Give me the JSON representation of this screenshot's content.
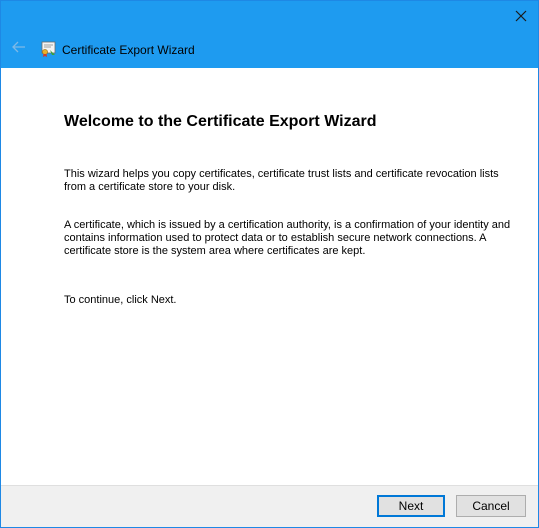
{
  "window": {
    "title": "Certificate Export Wizard",
    "accent_color": "#1e9bf0"
  },
  "titlebar": {
    "close_icon": "close-icon",
    "back_icon": "back-arrow-icon",
    "app_icon": "certificate-icon"
  },
  "content": {
    "heading": "Welcome to the Certificate Export Wizard",
    "paragraph1": "This wizard helps you copy certificates, certificate trust lists and certificate revocation lists from a certificate store to your disk.",
    "paragraph2": "A certificate, which is issued by a certification authority, is a confirmation of your identity and contains information used to protect data or to establish secure network connections. A certificate store is the system area where certificates are kept.",
    "paragraph3": "To continue, click Next."
  },
  "footer": {
    "next_label": "Next",
    "cancel_label": "Cancel"
  }
}
